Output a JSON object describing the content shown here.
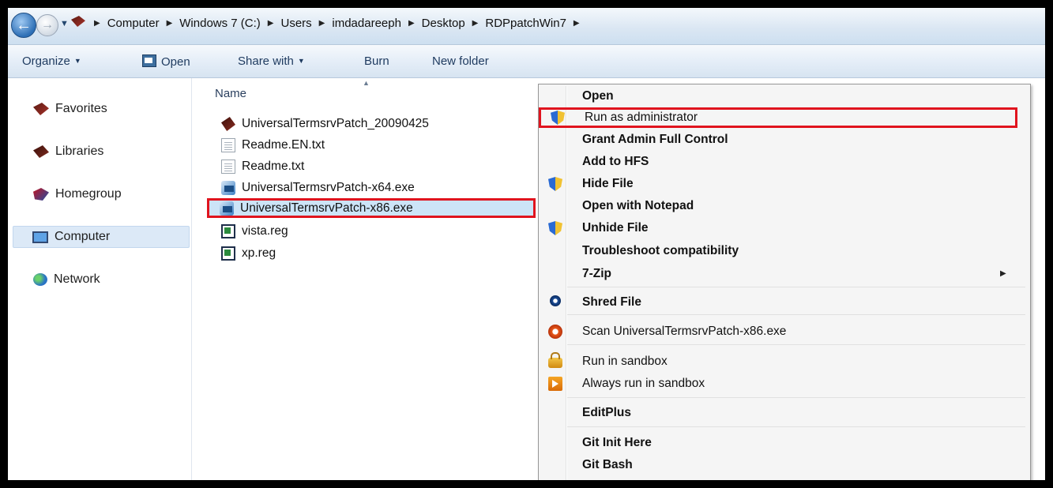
{
  "breadcrumb": {
    "items": [
      "Computer",
      "Windows 7 (C:)",
      "Users",
      "imdadareeph",
      "Desktop",
      "RDPpatchWin7"
    ]
  },
  "toolbar": {
    "organize": "Organize",
    "open": "Open",
    "share_with": "Share with",
    "burn": "Burn",
    "new_folder": "New folder"
  },
  "nav": {
    "favorites": "Favorites",
    "libraries": "Libraries",
    "homegroup": "Homegroup",
    "computer": "Computer",
    "network": "Network"
  },
  "files": {
    "column_name": "Name",
    "items": [
      "UniversalTermsrvPatch_20090425",
      "Readme.EN.txt",
      "Readme.txt",
      "UniversalTermsrvPatch-x64.exe",
      "UniversalTermsrvPatch-x86.exe",
      "vista.reg",
      "xp.reg"
    ],
    "selected": "UniversalTermsrvPatch-x86.exe"
  },
  "context_menu": {
    "items": [
      "Open",
      "Run as administrator",
      "Grant Admin Full Control",
      "Add to HFS",
      "Hide File",
      "Open with Notepad",
      "Unhide File",
      "Troubleshoot compatibility",
      "7-Zip",
      "Shred File",
      "Scan UniversalTermsrvPatch-x86.exe",
      "Run in sandbox",
      "Always run in sandbox",
      "EditPlus",
      "Git Init Here",
      "Git Bash"
    ]
  },
  "colors": {
    "highlight_border": "#e0141e",
    "selection_bg": "#cce4f7",
    "menu_bg": "#f5f5f5"
  }
}
